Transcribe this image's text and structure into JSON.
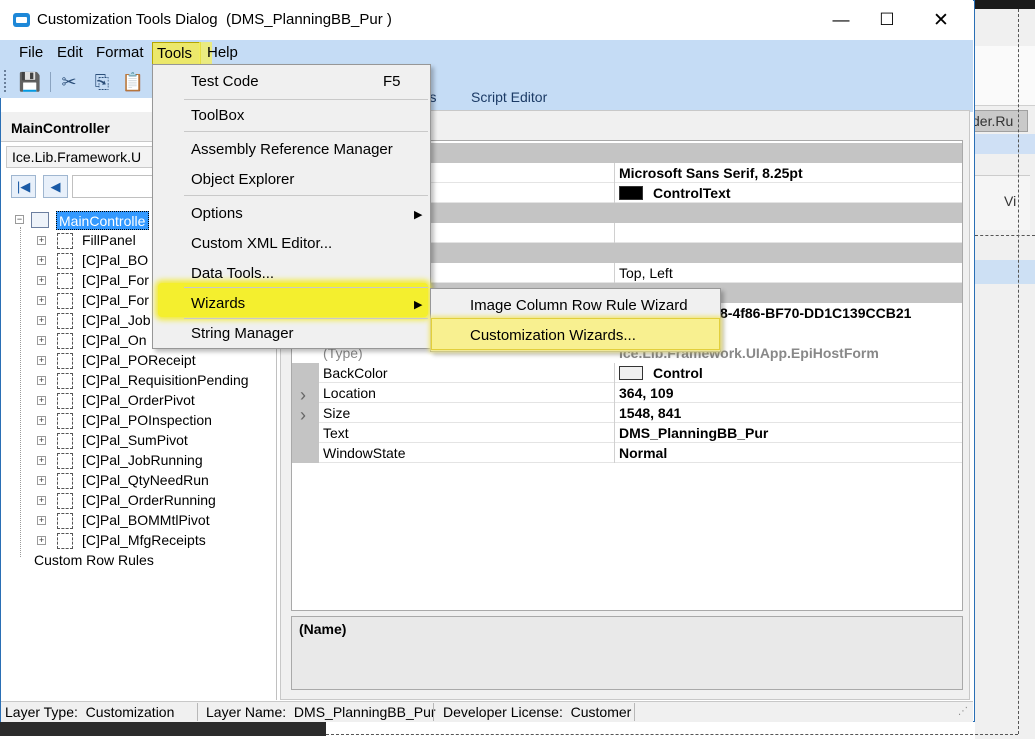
{
  "window": {
    "title": "Customization Tools Dialog  (DMS_PlanningBB_Pur )",
    "minimize_icon": "minimize-icon",
    "maximize_icon": "maximize-icon",
    "close_icon": "close-icon",
    "buttons": {
      "minimize": "—",
      "maximize": "☐",
      "close": "✕"
    }
  },
  "menubar": {
    "file": "File",
    "edit": "Edit",
    "format": "Format",
    "tools": "Tools",
    "help": "Help"
  },
  "toolbar": {
    "icons": [
      "save-icon",
      "cut-icon",
      "copy-icon",
      "paste-icon"
    ],
    "glyphs": {
      "save": "💾",
      "cut": "✂",
      "copy": "⎘",
      "paste": "📋"
    }
  },
  "left_pane": {
    "title": "MainController",
    "combo_value": "Ice.Lib.Framework.U",
    "nav": {
      "first": "|◀",
      "prev": "◀"
    },
    "tree": {
      "root": "MainControlle",
      "items": [
        "FillPanel",
        "[C]Pal_BO",
        "[C]Pal_For",
        "[C]Pal_For",
        "[C]Pal_Job",
        "[C]Pal_On",
        "[C]Pal_POReceipt",
        "[C]Pal_RequisitionPending",
        "[C]Pal_OrderPivot",
        "[C]Pal_POInspection",
        "[C]Pal_SumPivot",
        "[C]Pal_JobRunning",
        "[C]Pal_QtyNeedRun",
        "[C]Pal_OrderRunning",
        "[C]Pal_BOMMtlPivot",
        "[C]Pal_MfgReceipts"
      ],
      "footer": "Custom Row Rules"
    }
  },
  "tabs": {
    "partial": "rds",
    "script_editor": "Script Editor"
  },
  "property_grid": {
    "rows_top": [
      {
        "value": "Microsoft Sans Serif, 8.25pt",
        "bold": true
      },
      {
        "value": "ControlText",
        "bold": true,
        "swatch": "#000000"
      }
    ],
    "row_anchor": {
      "value": "Top, Left"
    },
    "partial_id": "8-4f86-BF70-DD1C139CCB21",
    "type_row": {
      "name": "(Type)",
      "value": "Ice.Lib.Framework.UIApp.EpiHostForm"
    },
    "rows": [
      {
        "name": "BackColor",
        "value": "Control",
        "swatch": "#f0f0f0",
        "expandable": false
      },
      {
        "name": "Location",
        "value": "364, 109",
        "expandable": true
      },
      {
        "name": "Size",
        "value": "1548, 841",
        "expandable": true
      },
      {
        "name": "Text",
        "value": "DMS_PlanningBB_Pur",
        "expandable": false
      },
      {
        "name": "WindowState",
        "value": "Normal",
        "expandable": false
      }
    ],
    "description_title": "(Name)"
  },
  "status_bar": {
    "layer_type": "Layer Type:  Customization",
    "layer_name": "Layer Name:  DMS_PlanningBB_Pur",
    "license": "Developer License:  Customer"
  },
  "tools_menu": {
    "items": [
      {
        "label": "Test Code",
        "shortcut": "F5"
      },
      {
        "label": "ToolBox"
      },
      {
        "label": "Assembly Reference Manager"
      },
      {
        "label": "Object Explorer"
      },
      {
        "label": "Options",
        "submenu": true
      },
      {
        "label": "Custom XML Editor..."
      },
      {
        "label": "Data Tools..."
      },
      {
        "label": "Wizards",
        "submenu": true,
        "highlighted": true
      },
      {
        "label": "String Manager"
      }
    ],
    "arrow_glyph": "▶"
  },
  "wizards_submenu": {
    "items": [
      {
        "label": "Image Column Row Rule Wizard"
      },
      {
        "label": "Customization Wizards...",
        "highlighted": true
      }
    ]
  },
  "background_app": {
    "tab_text": "der.Ru",
    "button_text": "Vi"
  },
  "colors": {
    "menubar": "#c5dcf5",
    "highlight": "#f4ef2e",
    "selection": "#3399ff"
  }
}
